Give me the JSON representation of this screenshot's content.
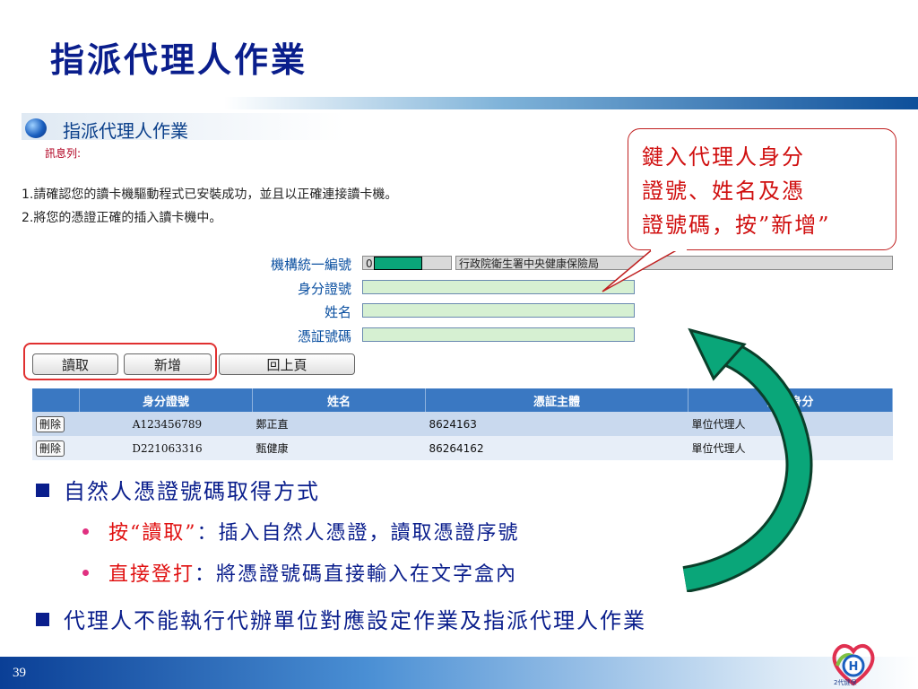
{
  "slide": {
    "title": "指派代理人作業",
    "page_number": "39"
  },
  "app": {
    "title": "指派代理人作業",
    "message_label": "訊息列:",
    "notes": [
      "1.請確認您的讀卡機驅動程式已安裝成功，並且以正確連接讀卡機。",
      "2.將您的憑證正確的插入讀卡機中。"
    ],
    "form": {
      "org_id_label": "機構統一編號",
      "org_id_value": "0",
      "org_name_value": "行政院衛生署中央健康保險局",
      "id_label": "身分證號",
      "name_label": "姓名",
      "cert_label": "憑証號碼"
    },
    "buttons": {
      "read": "讀取",
      "add": "新增",
      "back": "回上頁"
    },
    "table": {
      "headers": [
        "",
        "身分證號",
        "姓名",
        "憑証主體",
        "登入身分"
      ],
      "rows": [
        {
          "action": "刪除",
          "id": "A123456789",
          "name": "鄭正直",
          "cert": "8624163",
          "role": "單位代理人"
        },
        {
          "action": "刪除",
          "id": "D221063316",
          "name": "甄健康",
          "cert": "86264162",
          "role": "單位代理人"
        }
      ]
    }
  },
  "callout": {
    "line1": "鍵入代理人身分",
    "line2": "證號、姓名及憑",
    "line3": "證號碼，按”新增”"
  },
  "bullets": {
    "item1": "自然人憑證號碼取得方式",
    "sub1_red": "按“讀取”",
    "sub1_blue": "：插入自然人憑證，讀取憑證序號",
    "sub2_red": "直接登打",
    "sub2_blue": "：將憑證號碼直接輸入在文字盒內",
    "item2": "代理人不能執行代辦單位對應設定作業及指派代理人作業"
  },
  "logo": {
    "text": "2代健保"
  },
  "colors": {
    "title": "#0a1e8c",
    "callout_text": "#d01010",
    "arrow": "#0aa679",
    "table_header": "#3a78c2"
  }
}
